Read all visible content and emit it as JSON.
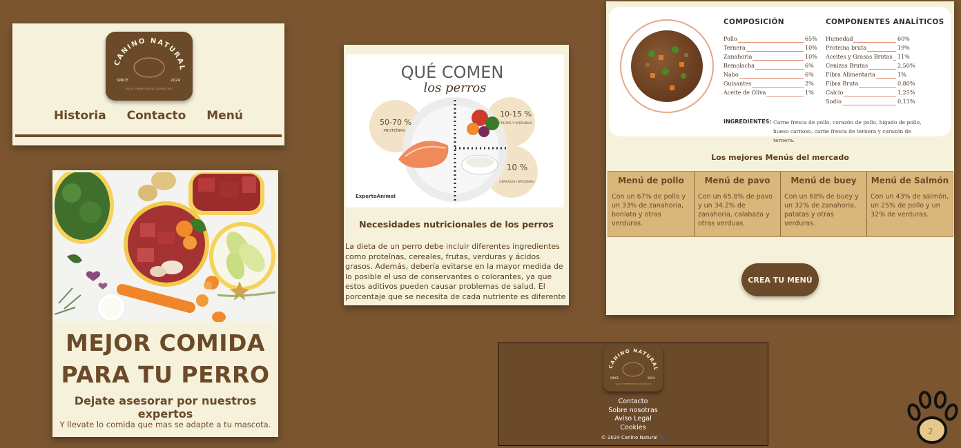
{
  "logo": {
    "brand": "CANINO NATURAL",
    "since": "SINCE",
    "year": "2024",
    "tagline": "SALUD Y BIENESTAR EN CADA BOCADO"
  },
  "nav": {
    "items": [
      "Historia",
      "Contacto",
      "Menú"
    ]
  },
  "hero": {
    "title_line1": "MEJOR COMIDA",
    "title_line2": "PARA TU PERRO",
    "subtitle": "Dejate asesorar por nuestros expertos",
    "tagline": "Y llevate lo comida que mas se adapte a tu mascota."
  },
  "article": {
    "infographic": {
      "title": "QUÉ COMEN",
      "subtitle": "los perros",
      "protein_pct": "50-70 %",
      "protein_label": "PROTEÍNAS",
      "fruit_pct": "10-15 %",
      "fruit_label": "FRUTAS Y VERDURAS",
      "cereal_pct": "10 %",
      "cereal_label": "CEREALES (OPCIONAL)",
      "source": "ExpertoAnimal"
    },
    "heading": "Necesidades nutricionales de los perros",
    "body": "La dieta de un perro debe incluir diferentes ingredientes como proteínas, cereales, frutas, verduras y ácidos grasos. Además, debería evitarse en la mayor medida de lo posible el uso de conservantes o colorantes, ya que estos aditivos pueden causar problemas de salud. El porcentaje que se necesita de cada nutriente es diferente"
  },
  "composition": {
    "title": "COMPOSICIÓN",
    "rows": [
      {
        "name": "Pollo",
        "value": "65%"
      },
      {
        "name": "Ternera",
        "value": "10%"
      },
      {
        "name": "Zanahoria",
        "value": "10%"
      },
      {
        "name": "Remolacha",
        "value": "6%"
      },
      {
        "name": "Nabo",
        "value": "6%"
      },
      {
        "name": "Guisantes",
        "value": "2%"
      },
      {
        "name": "Aceite de Oliva",
        "value": "1%"
      }
    ]
  },
  "analytics": {
    "title": "COMPONENTES ANALÍTICOS",
    "rows": [
      {
        "name": "Humedad",
        "value": "60%"
      },
      {
        "name": "Proteina bruta",
        "value": "19%"
      },
      {
        "name": "Aceites y Grasas Brutas",
        "value": "11%"
      },
      {
        "name": "Cenizas Brutas",
        "value": "2,50%"
      },
      {
        "name": "Fibra Alimentaria",
        "value": "1%"
      },
      {
        "name": "Fibra Bruta",
        "value": "0,80%"
      },
      {
        "name": "Calcio",
        "value": "1,25%"
      },
      {
        "name": "Sodio",
        "value": "0,13%"
      }
    ]
  },
  "ingredients": {
    "label": "INGREDIENTES:",
    "text": "Carne fresca de pollo, corazón de pollo, hígado de pollo, hueso carnoso, carne fresca de ternera y corazón de ternera."
  },
  "menus": {
    "heading": "Los mejores Menús del mercado",
    "items": [
      {
        "name": "Menú de pollo",
        "desc": "Con un 67% de pollo y un 33% de zanahoria, boniato y otras verduras."
      },
      {
        "name": "Menú de pavo",
        "desc": "Con un 65.8% de pavo y un 34.2% de zanahoria, calabaza y otras verduas."
      },
      {
        "name": "Menú de buey",
        "desc": "Con un 68% de buey y un 32% de zanahoria, patatas y otras verduras."
      },
      {
        "name": "Menú de Salmón",
        "desc": "Con un 43% de salmón, un 25% de pollo y un 32% de verduras."
      }
    ],
    "cta": "CREA TU MENÚ"
  },
  "footer": {
    "links": [
      "Contacto",
      "Sobre nosotras",
      "Aviso Legal",
      "Cookies"
    ],
    "copyright": "© 2024 Canino Natural 🐾"
  },
  "page_number": "2",
  "colors": {
    "background": "#7a5530",
    "card": "#f6f1da",
    "brand_brown": "#6b4a2a",
    "menu_tile": "#d9b67a"
  }
}
